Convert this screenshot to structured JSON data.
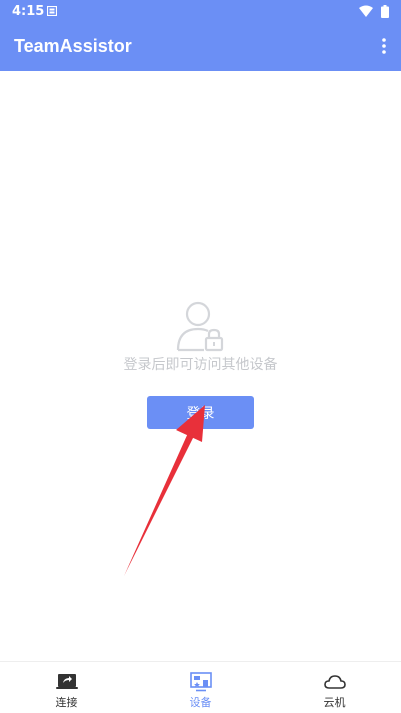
{
  "status_bar": {
    "time": "4:15"
  },
  "app_bar": {
    "title": "TeamAssistor"
  },
  "content": {
    "hint": "登录后即可访问其他设备",
    "login_label": "登录"
  },
  "bottom_nav": {
    "items": [
      {
        "label": "连接",
        "icon": "screen-share-icon"
      },
      {
        "label": "设备",
        "icon": "devices-icon",
        "active": true
      },
      {
        "label": "云机",
        "icon": "cloud-icon"
      }
    ]
  },
  "colors": {
    "primary": "#6b8ff5",
    "hint_text": "#c6c8cc",
    "annotation_arrow": "#e8303a"
  }
}
